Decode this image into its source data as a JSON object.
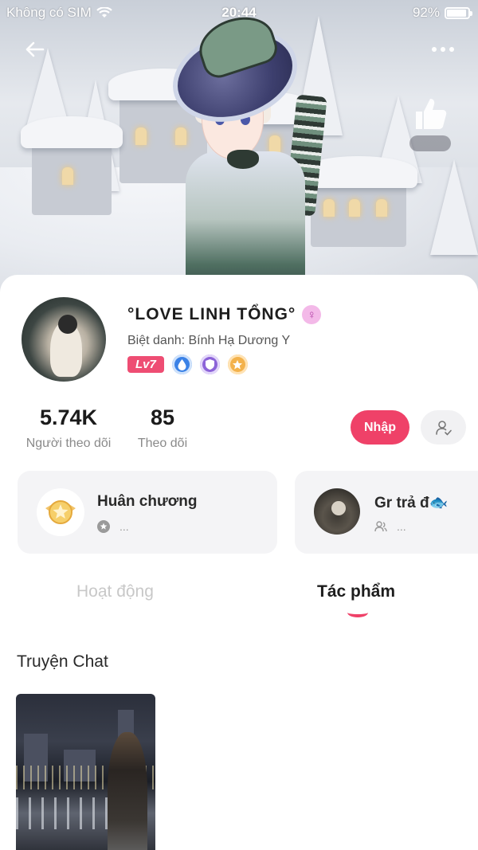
{
  "status_bar": {
    "carrier": "Không có SIM",
    "time": "20:44",
    "battery_percent": "92%",
    "battery_level": 0.92
  },
  "icons": {
    "back": "arrow-left-icon",
    "more": "more-dots-icon",
    "like": "thumbs-up-icon",
    "gender": "female-symbol-icon",
    "follow": "user-check-icon"
  },
  "profile": {
    "name": "°LOVE LINH TỔNG°",
    "gender_symbol": "♀",
    "nickname": "Biệt danh: Bính Hạ Dương Y",
    "level": "Lv7"
  },
  "stats": {
    "followers_count": "5.74K",
    "followers_label": "Người theo dõi",
    "following_count": "85",
    "following_label": "Theo dõi"
  },
  "actions": {
    "enter_label": "Nhập"
  },
  "panels": {
    "medal_title": "Huân chương",
    "medal_sub": "...",
    "group_title": "Gr trả đ🐟",
    "group_sub": "..."
  },
  "tabs": [
    {
      "label": "Hoạt động",
      "active": false
    },
    {
      "label": "Tác phẩm",
      "active": true
    }
  ],
  "section": {
    "title": "Truyện Chat"
  },
  "colors": {
    "accent": "#ef4168",
    "level_badge": "#ee4d73"
  }
}
